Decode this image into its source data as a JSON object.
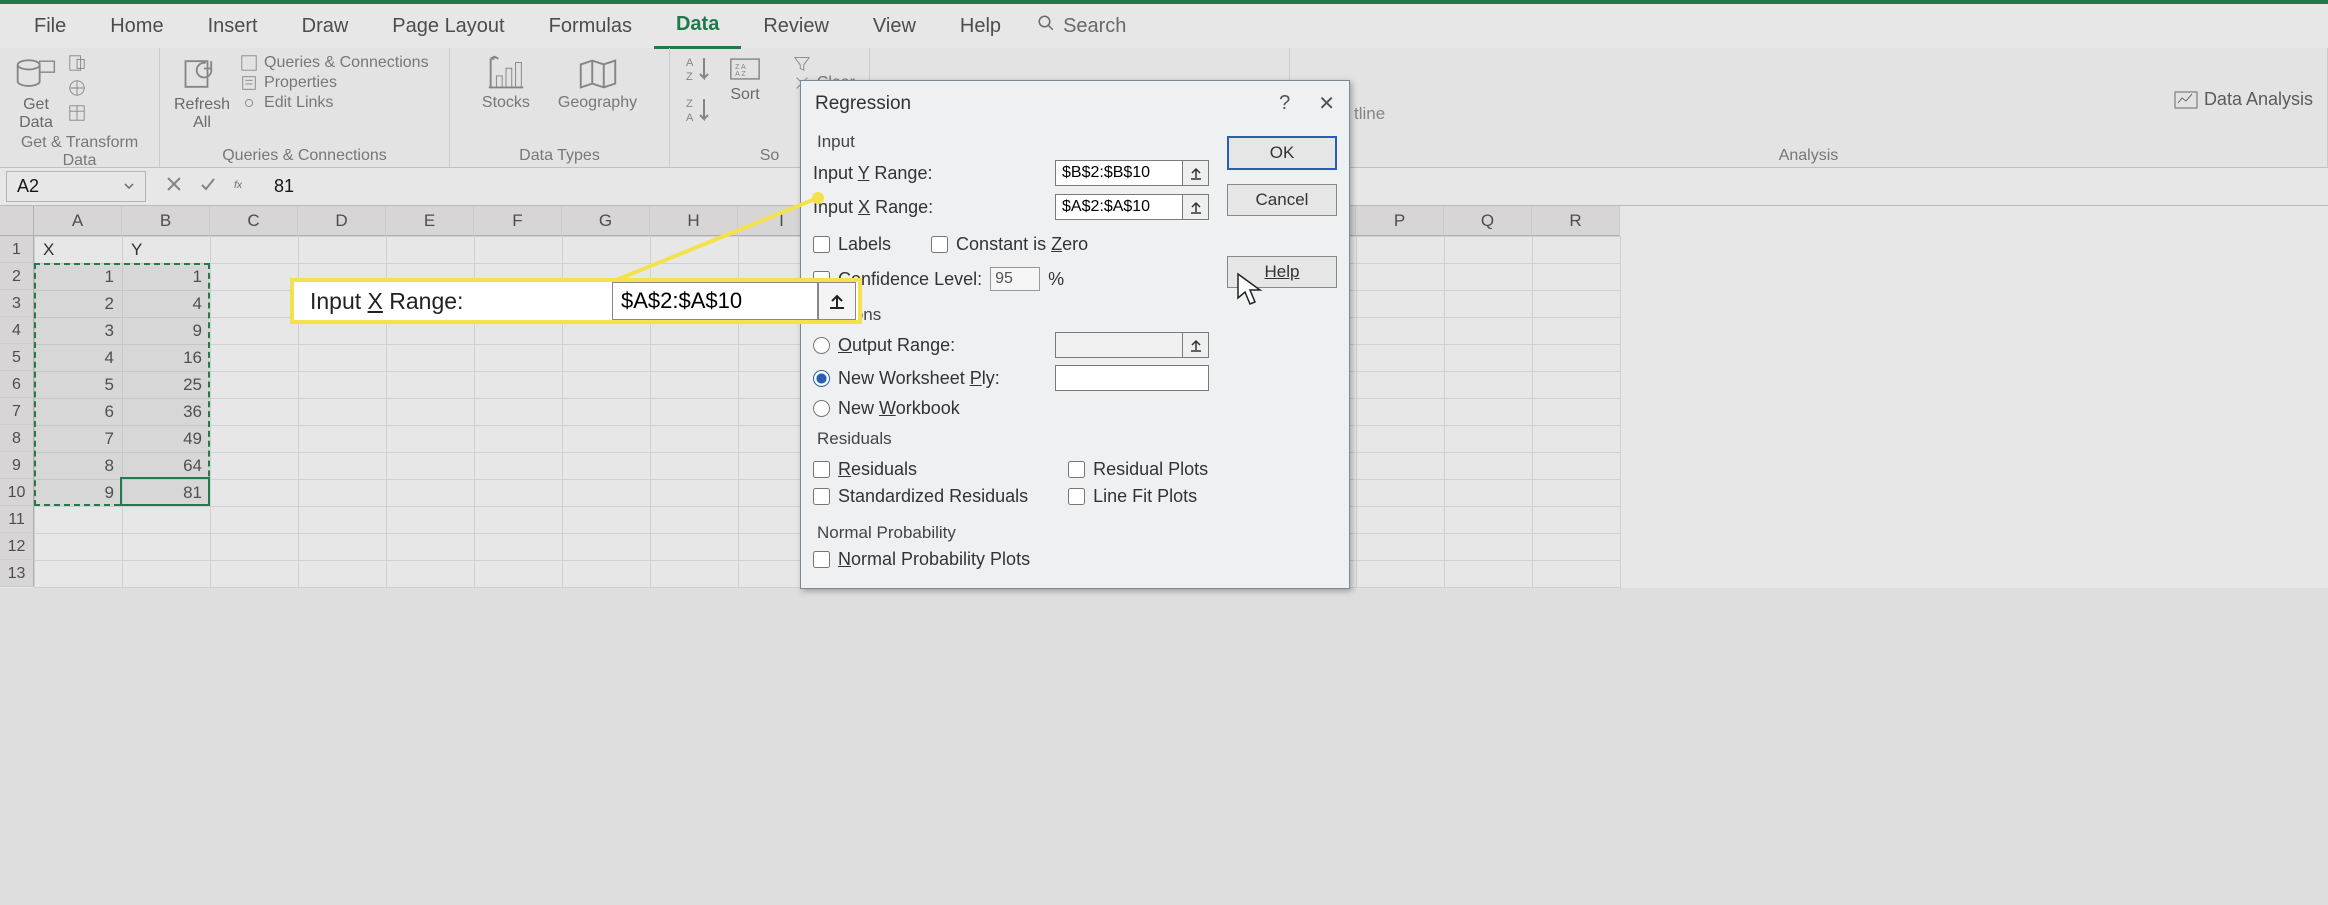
{
  "tabs": {
    "file": "File",
    "home": "Home",
    "insert": "Insert",
    "draw": "Draw",
    "page_layout": "Page Layout",
    "formulas": "Formulas",
    "data": "Data",
    "review": "Review",
    "view": "View",
    "help": "Help",
    "search": "Search"
  },
  "ribbon": {
    "get_data": "Get\nData",
    "refresh_all": "Refresh\nAll",
    "queries_connections": "Queries & Connections",
    "properties": "Properties",
    "edit_links": "Edit Links",
    "stocks": "Stocks",
    "geography": "Geography",
    "sort": "Sort",
    "clear": "Clear",
    "data_analysis": "Data Analysis",
    "outline": "tline",
    "group_get_transform": "Get & Transform Data",
    "group_queries": "Queries & Connections",
    "group_data_types": "Data Types",
    "group_sort_prefix": "So",
    "group_analysis": "Analysis"
  },
  "formula_bar": {
    "name_box": "A2",
    "formula": "81"
  },
  "columns": [
    "A",
    "B",
    "C",
    "D",
    "E",
    "F",
    "G",
    "H",
    "I",
    "P",
    "Q",
    "R"
  ],
  "row_numbers": [
    "1",
    "2",
    "3",
    "4",
    "5",
    "6",
    "7",
    "8",
    "9",
    "10",
    "11",
    "12",
    "13"
  ],
  "sheet": {
    "header_a": "X",
    "header_b": "Y",
    "rows": [
      {
        "a": "1",
        "b": "1"
      },
      {
        "a": "2",
        "b": "4"
      },
      {
        "a": "3",
        "b": "9"
      },
      {
        "a": "4",
        "b": "16"
      },
      {
        "a": "5",
        "b": "25"
      },
      {
        "a": "6",
        "b": "36"
      },
      {
        "a": "7",
        "b": "49"
      },
      {
        "a": "8",
        "b": "64"
      },
      {
        "a": "9",
        "b": "81"
      }
    ]
  },
  "dialog": {
    "title": "Regression",
    "help_glyph": "?",
    "close_glyph": "✕",
    "input_section": "Input",
    "input_y_label": "Input Y Range:",
    "input_y_value": "$B$2:$B$10",
    "input_x_label": "Input X Range:",
    "input_x_value": "$A$2:$A$10",
    "labels_chk": "Labels",
    "const_zero_chk": "Constant is Zero",
    "confidence_chk": "Confidence Level:",
    "confidence_value": "95",
    "confidence_suffix": "%",
    "output_options_partial": "t options",
    "output_range": "Output Range:",
    "new_worksheet": "New Worksheet Ply:",
    "new_workbook": "New Workbook",
    "residuals_section": "Residuals",
    "residuals_chk": "Residuals",
    "std_residuals_chk": "Standardized Residuals",
    "residual_plots_chk": "Residual Plots",
    "line_fit_chk": "Line Fit Plots",
    "normal_section": "Normal Probability",
    "normal_plots_chk": "Normal Probability Plots",
    "ok": "OK",
    "cancel": "Cancel",
    "help": "Help"
  },
  "callout": {
    "label": "Input X Range:",
    "value": "$A$2:$A$10"
  }
}
